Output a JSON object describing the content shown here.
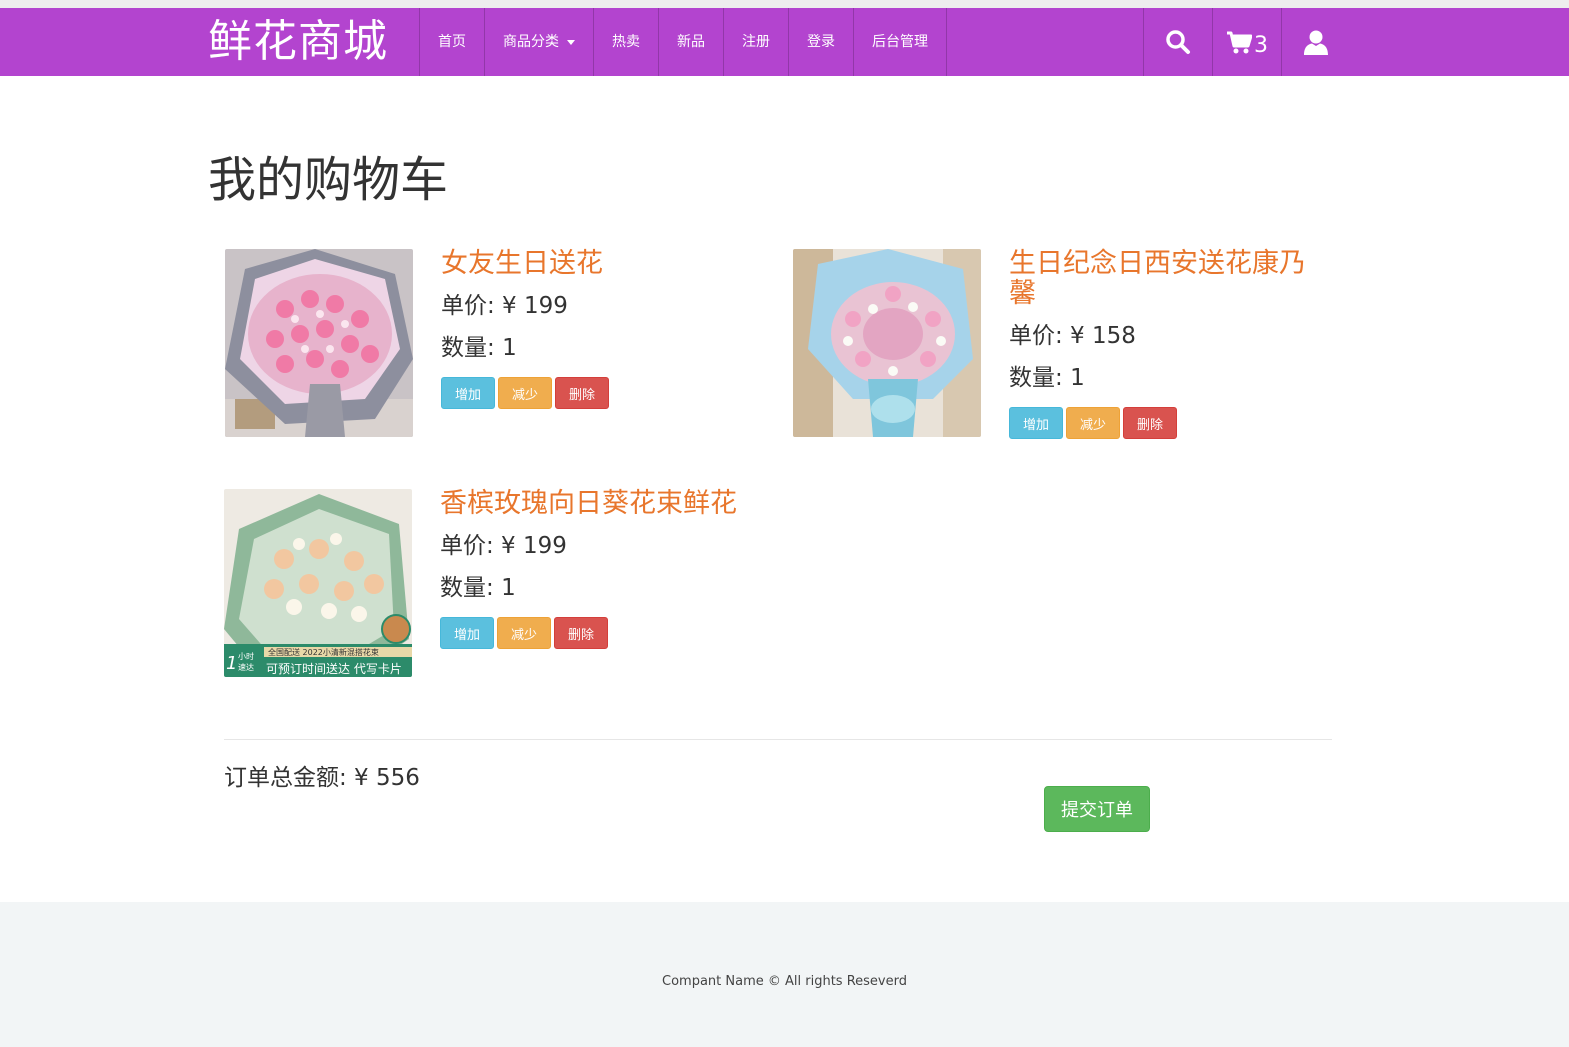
{
  "brand": "鲜花商城",
  "nav": {
    "items": [
      "首页",
      "商品分类",
      "热卖",
      "新品",
      "注册",
      "登录",
      "后台管理"
    ],
    "cart_count": "3"
  },
  "page_title": "我的购物车",
  "cart": {
    "price_label": "单价: ¥ ",
    "qty_label": "数量: ",
    "buttons": {
      "add": "增加",
      "minus": "减少",
      "delete": "删除"
    },
    "items": [
      {
        "name": "女友生日送花",
        "price": "199",
        "qty": "1",
        "image": "pink-rose-bouquet"
      },
      {
        "name": "生日纪念日西安送花康乃馨",
        "price": "158",
        "qty": "1",
        "image": "pink-carnation-bouquet"
      },
      {
        "name": "香槟玫瑰向日葵花束鲜花",
        "price": "199",
        "qty": "1",
        "image": "champagne-rose-bouquet",
        "banner_small": "全国配送 2022小清新混搭花束",
        "banner_big": "可预订时间送达 代写卡片",
        "badge_top": "小时",
        "badge_bottom": "速达",
        "badge_num": "1"
      }
    ]
  },
  "total_label": "订单总金额: ¥ 556",
  "submit_label": "提交订单",
  "footer_text": "Compant Name © All rights Reseverd",
  "colors": {
    "navbar": "#b344cf",
    "product_name": "#e8762c",
    "add": "#5bc0de",
    "minus": "#f0ad4e",
    "delete": "#d9534f",
    "submit": "#5cb85c"
  }
}
